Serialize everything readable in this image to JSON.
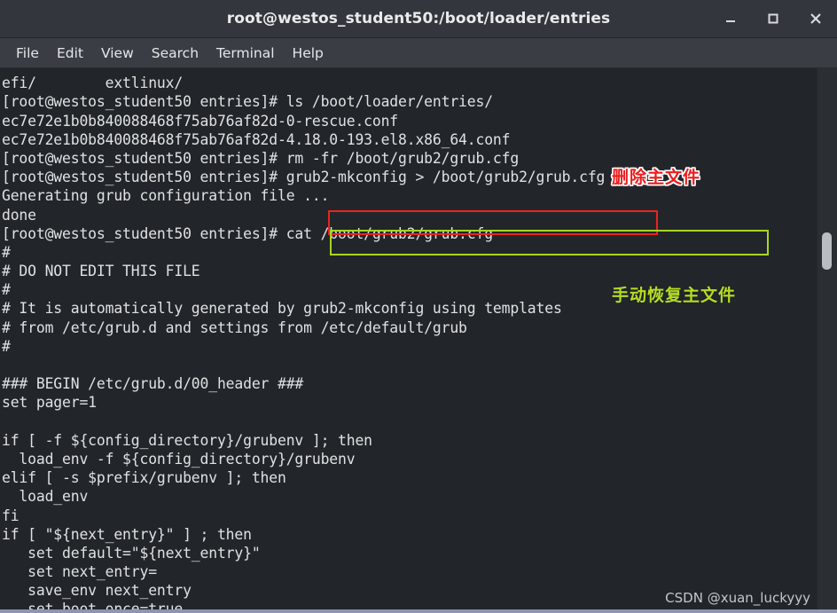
{
  "window": {
    "title": "root@westos_student50:/boot/loader/entries",
    "controls": [
      {
        "name": "minimize-button",
        "glyph": "minimize"
      },
      {
        "name": "maximize-button",
        "glyph": "maximize"
      },
      {
        "name": "close-button",
        "glyph": "close"
      }
    ]
  },
  "menubar": {
    "items": [
      {
        "label": "File"
      },
      {
        "label": "Edit"
      },
      {
        "label": "View"
      },
      {
        "label": "Search"
      },
      {
        "label": "Terminal"
      },
      {
        "label": "Help"
      }
    ]
  },
  "terminal": {
    "lines": [
      "                                                      ",
      "efi/        extlinux/",
      "[root@westos_student50 entries]# ls /boot/loader/entries/",
      "ec7e72e1b0b840088468f75ab76af82d-0-rescue.conf",
      "ec7e72e1b0b840088468f75ab76af82d-4.18.0-193.el8.x86_64.conf",
      "[root@westos_student50 entries]# rm -fr /boot/grub2/grub.cfg",
      "[root@westos_student50 entries]# grub2-mkconfig > /boot/grub2/grub.cfg",
      "Generating grub configuration file ...",
      "done",
      "[root@westos_student50 entries]# cat /boot/grub2/grub.cfg",
      "#",
      "# DO NOT EDIT THIS FILE",
      "#",
      "# It is automatically generated by grub2-mkconfig using templates",
      "# from /etc/grub.d and settings from /etc/default/grub",
      "#",
      "",
      "### BEGIN /etc/grub.d/00_header ###",
      "set pager=1",
      "",
      "if [ -f ${config_directory}/grubenv ]; then",
      "  load_env -f ${config_directory}/grubenv",
      "elif [ -s $prefix/grubenv ]; then",
      "  load_env",
      "fi",
      "if [ \"${next_entry}\" ] ; then",
      "   set default=\"${next_entry}\"",
      "   set next_entry=",
      "   save_env next_entry",
      "   set boot once=true"
    ]
  },
  "annotations": [
    {
      "name": "annotation-delete-main-file",
      "text": "删除主文件",
      "color": "#ec1d1d"
    },
    {
      "name": "annotation-manual-restore-main-file",
      "text": "手动恢复主文件",
      "color": "#b5dc22"
    }
  ],
  "highlights": [
    {
      "name": "highlight-box-rm-command",
      "color": "#e8251f"
    },
    {
      "name": "highlight-box-mkconfig-command",
      "color": "#a9d61e"
    }
  ],
  "watermark": {
    "text": "CSDN @xuan_luckyyy"
  }
}
